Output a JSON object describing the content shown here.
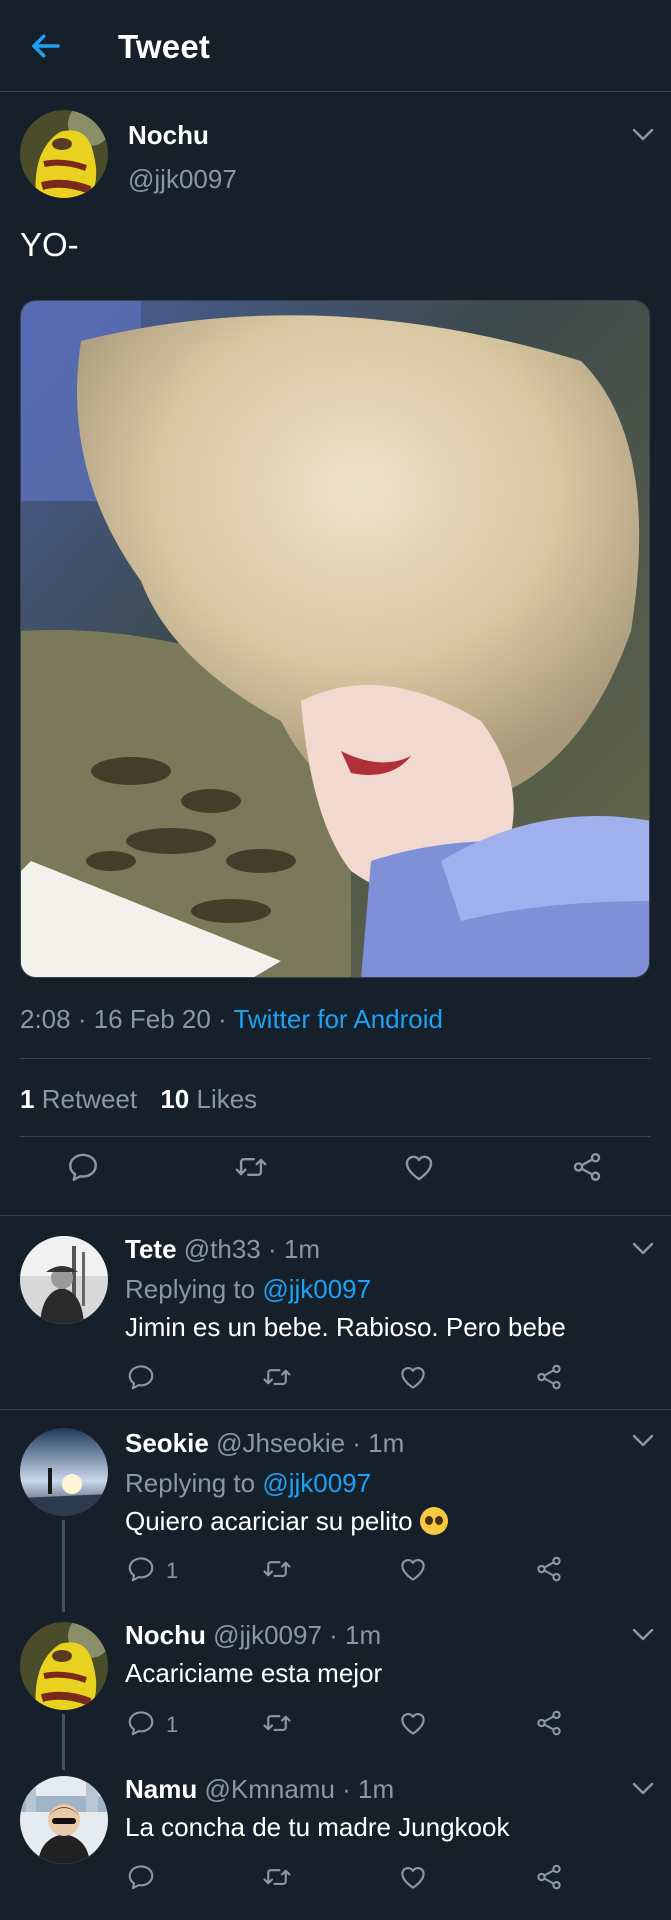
{
  "header": {
    "title": "Tweet",
    "back_icon": "arrow-left-icon"
  },
  "colors": {
    "background": "#15202b",
    "accent": "#1da1f2",
    "muted": "#8899a6",
    "border": "#38444d"
  },
  "tweet": {
    "name": "Nochu",
    "handle": "@jjk0097",
    "text": "YO-",
    "time": "2:08 · 16 Feb 20 · ",
    "source": "Twitter for Android",
    "retweets_count": "1",
    "retweets_label": "Retweet",
    "likes_count": "10",
    "likes_label": "Likes"
  },
  "replies": [
    {
      "name": "Tete",
      "handle": "@th33 · 1m",
      "replying_prefix": "Replying to ",
      "replying_to": "@jjk0097",
      "text": "Jimin es un bebe. Rabioso. Pero bebe",
      "reply_count": ""
    },
    {
      "name": "Seokie",
      "handle": "@Jhseokie · 1m",
      "replying_prefix": "Replying to ",
      "replying_to": "@jjk0097",
      "text": "Quiero acariciar su pelito ",
      "emoji": "pleading-face",
      "reply_count": "1"
    },
    {
      "name": "Nochu",
      "handle": "@jjk0097 · 1m",
      "text": "Acariciame esta mejor",
      "reply_count": "1"
    },
    {
      "name": "Namu",
      "handle": "@Kmnamu · 1m",
      "text": "La concha de tu madre Jungkook",
      "reply_count": ""
    }
  ]
}
